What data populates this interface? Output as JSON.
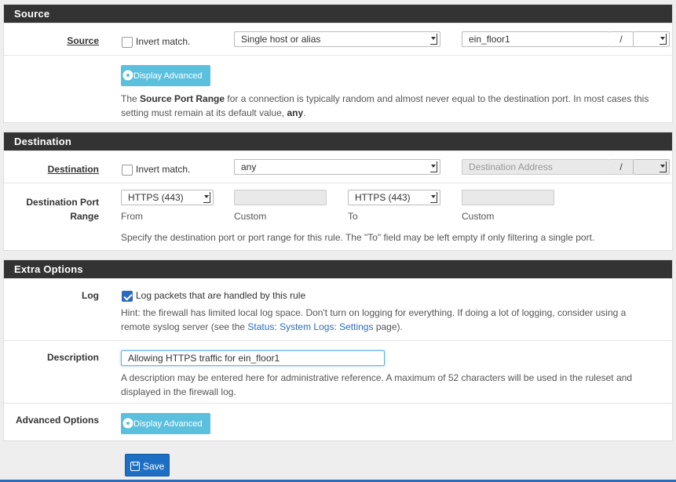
{
  "source": {
    "heading": "Source",
    "label": "Source",
    "invert_label": "Invert match.",
    "type_select": "Single host or alias",
    "address_value": "ein_floor1",
    "slash": "/",
    "advanced_button": "Display Advanced",
    "help_pre": "The ",
    "help_bold": "Source Port Range",
    "help_mid": " for a connection is typically random and almost never equal to the destination port. In most cases this setting must remain at its default value, ",
    "help_any": "any",
    "help_end": "."
  },
  "destination": {
    "heading": "Destination",
    "label": "Destination",
    "invert_label": "Invert match.",
    "type_select": "any",
    "address_placeholder": "Destination Address",
    "slash": "/",
    "port_label_1": "Destination Port",
    "port_label_2": "Range",
    "from_select": "HTTPS (443)",
    "to_select": "HTTPS (443)",
    "from_label": "From",
    "custom_label_1": "Custom",
    "to_label": "To",
    "custom_label_2": "Custom",
    "port_help": "Specify the destination port or port range for this rule. The \"To\" field may be left empty if only filtering a single port."
  },
  "extra": {
    "heading": "Extra Options",
    "log_label": "Log",
    "log_checkbox_label": "Log packets that are handled by this rule",
    "log_checked": true,
    "log_help_1": "Hint: the firewall has limited local log space. Don't turn on logging for everything. If doing a lot of logging, consider using a",
    "log_help_2_pre": "remote syslog server (see the ",
    "log_help_link": "Status: System Logs: Settings",
    "log_help_2_post": " page).",
    "description_label": "Description",
    "description_value": "Allowing HTTPS traffic for ein_floor1",
    "description_help_1": "A description may be entered here for administrative reference. A maximum of 52 characters will be used in the ruleset and",
    "description_help_2": "displayed in the firewall log.",
    "advanced_label": "Advanced Options",
    "advanced_button": "Display Advanced"
  },
  "save_button": "Save",
  "colors": {
    "header": "#333333",
    "info_button": "#5bc0de",
    "primary": "#1e6fc4",
    "link": "#2a6bbf"
  },
  "icons": {
    "advanced": "gear-icon",
    "save": "floppy-disk-icon"
  }
}
